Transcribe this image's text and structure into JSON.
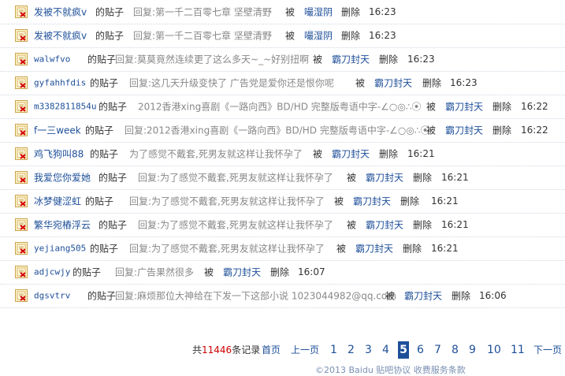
{
  "rows": [
    {
      "user": "发被不就疯v",
      "mid": "的贴子",
      "subject": "回复:第一千二百零七章 坚壁清野",
      "by": "被",
      "operator": "嘬湿阴",
      "action": "删除",
      "time": "16:23"
    },
    {
      "user": "发被不就疯v",
      "mid": "的贴子",
      "subject": "回复:第一千二百零七章 坚壁清野",
      "by": "被",
      "operator": "嘬湿阴",
      "action": "删除",
      "time": "16:23"
    },
    {
      "user": "walwfvo",
      "mid": "的贴子",
      "subject": "回复:莫莫竟然连续更了这么多天~_~好别扭啊",
      "by": "被",
      "operator": "霸刀封天",
      "action": "删除",
      "time": "16:23"
    },
    {
      "user": "gyfahhfdis",
      "mid": "的贴子",
      "subject": "回复:这几天升级变快了 广告党是爱你还是恨你呢",
      "by": "被",
      "operator": "霸刀封天",
      "action": "删除",
      "time": "16:23"
    },
    {
      "user": "m3382811854u",
      "mid": "的贴子",
      "subject": "2012香港xing喜剧《一路向西》BD/HD 完整版粤语中字-∠○◎∴⦿",
      "by": "被",
      "operator": "霸刀封天",
      "action": "删除",
      "time": "16:22"
    },
    {
      "user": "f一三week",
      "mid": "的贴子",
      "subject": "回复:2012香港xing喜剧《一路向西》BD/HD 完整版粤语中字-∠○◎∴⦿",
      "by": "被",
      "operator": "霸刀封天",
      "action": "删除",
      "time": "16:22"
    },
    {
      "user": "鸡飞狗叫88",
      "mid": "的贴子",
      "subject": "为了感觉不戴套,死男友就这样让我怀孕了",
      "by": "被",
      "operator": "霸刀封天",
      "action": "删除",
      "time": "16:21"
    },
    {
      "user": "我爱您你爱她",
      "mid": "的贴子",
      "subject": "回复:为了感觉不戴套,死男友就这样让我怀孕了",
      "by": "被",
      "operator": "霸刀封天",
      "action": "删除",
      "time": "16:21"
    },
    {
      "user": "冰梦健涩虹",
      "mid": "的贴子",
      "subject": "回复:为了感觉不戴套,死男友就这样让我怀孕了",
      "by": "被",
      "operator": "霸刀封天",
      "action": "删除",
      "time": "16:21"
    },
    {
      "user": "繁华宛樁浮云",
      "mid": "的贴子",
      "subject": "回复:为了感觉不戴套,死男友就这样让我怀孕了",
      "by": "被",
      "operator": "霸刀封天",
      "action": "删除",
      "time": "16:21"
    },
    {
      "user": "yejiang505",
      "mid": "的贴子",
      "subject": "回复:为了感觉不戴套,死男友就这样让我怀孕了",
      "by": "被",
      "operator": "霸刀封天",
      "action": "删除",
      "time": "16:21"
    },
    {
      "user": "adjcwjy",
      "mid": "的贴子",
      "subject": "回复:广告果然很多",
      "by": "被",
      "operator": "霸刀封天",
      "action": "删除",
      "time": "16:07"
    },
    {
      "user": "dgsvtrv",
      "mid": "的贴子",
      "subject": "回复:麻烦那位大神给在下发一下这部小说 1023044982@qq.com",
      "by": "被",
      "operator": "霸刀封天",
      "action": "删除",
      "time": "16:06"
    }
  ],
  "pagination": {
    "total_prefix": "共",
    "total_count": "11446",
    "total_suffix": "条记录",
    "first": "首页",
    "prev": "上一页",
    "pages": [
      "1",
      "2",
      "3",
      "4",
      "5",
      "6",
      "7",
      "8",
      "9",
      "10",
      "11"
    ],
    "current": "5",
    "next": "下一页"
  },
  "footer": "©2013 Baidu 贴吧协议 收费服务条款"
}
